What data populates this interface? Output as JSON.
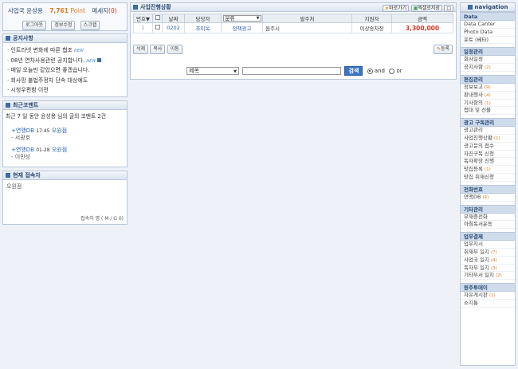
{
  "user": {
    "name": "사업국 윤성용",
    "points": "7,761",
    "points_unit": "Point",
    "messages_label": "메세지",
    "messages_count": "(0)",
    "buttons": [
      "로그아웃",
      "정보수정",
      "스크랩"
    ]
  },
  "notice": {
    "title": "공지사항",
    "items": [
      {
        "text": "인트라넷 변화에 따른 협조",
        "new": "NEW"
      },
      {
        "text": "08년 연차사용관련 공지합니다.",
        "new": "NEW"
      },
      {
        "text": "매일 오늘만 같았으면 좋겠습니다.",
        "new": ""
      },
      {
        "text": "회사망 불법주정차 단속 대상예도",
        "new": ""
      },
      {
        "text": "시청우편함 이전",
        "new": ""
      }
    ]
  },
  "comments": {
    "title": "최근코멘트",
    "summary": "최근 7 일 동안 윤성용 님의 글의 코멘트 2건",
    "items": [
      {
        "prefix": "+연맹DB",
        "time": "17:45",
        "author": "오원점",
        "text": "- 서광호"
      },
      {
        "prefix": "+연맹DB",
        "time": "01-28",
        "author": "오원점",
        "text": "- 이민성"
      }
    ]
  },
  "online": {
    "title": "현재 접속자",
    "users": [
      "오원점"
    ],
    "footer": "접속자 명 ( M / G 0)"
  },
  "main": {
    "title": "사업진행상황",
    "top_buttons": [
      "바로가기",
      "엑셀로저장"
    ],
    "columns": [
      "번호▼",
      "",
      "날짜",
      "담당자",
      "분류",
      "발주처",
      "지원자",
      "금액"
    ],
    "category_select": "분류",
    "rows": [
      {
        "no": "1",
        "date": "0202",
        "manager": "조미옥",
        "category": "정책광고",
        "client": "원주시",
        "support": "이상송차장",
        "amount": "3,300,000"
      }
    ],
    "actions": [
      "삭제",
      "복사",
      "이동"
    ],
    "register_button": "등록",
    "search": {
      "field_option": "제목",
      "value": "",
      "button": "검색",
      "radio_and": "and",
      "radio_or": "or"
    }
  },
  "nav": {
    "title": "navigation",
    "sections": [
      {
        "title": "Data",
        "items": [
          {
            "label": "Data Canter",
            "count": ""
          },
          {
            "label": "Photo Data",
            "count": ""
          },
          {
            "label": "포토 (베타)",
            "count": ""
          }
        ]
      },
      {
        "title": "일정관리",
        "items": [
          {
            "label": "회사일정",
            "count": ""
          },
          {
            "label": "공지사항",
            "count": "(2)"
          }
        ]
      },
      {
        "title": "편집관리",
        "items": [
          {
            "label": "정보보고",
            "count": "(9)"
          },
          {
            "label": "판내행사",
            "count": "(4)"
          },
          {
            "label": "기사항의",
            "count": "(1)"
          },
          {
            "label": "접대 및 선물",
            "count": ""
          }
        ]
      },
      {
        "title": "광고 구독관리",
        "items": [
          {
            "label": "광고관리",
            "count": ""
          },
          {
            "label": "사업진행상황",
            "count": "(1)"
          },
          {
            "label": "광고문의 접수",
            "count": ""
          },
          {
            "label": "자진구독 신청",
            "count": ""
          },
          {
            "label": "독자확장 진행",
            "count": ""
          },
          {
            "label": "맛집등록",
            "count": "(1)"
          },
          {
            "label": "맛집 취재신청",
            "count": ""
          }
        ]
      },
      {
        "title": "전화번호",
        "items": [
          {
            "label": "연맹DB",
            "count": "(4)"
          }
        ]
      },
      {
        "title": "기타관리",
        "items": [
          {
            "label": "부재중전화",
            "count": ""
          },
          {
            "label": "아침독서운동",
            "count": ""
          }
        ]
      },
      {
        "title": "업무결제",
        "items": [
          {
            "label": "업무지시",
            "count": ""
          },
          {
            "label": "취재부 일지",
            "count": "(7)"
          },
          {
            "label": "사업국 일지",
            "count": "(4)"
          },
          {
            "label": "독자부 일지",
            "count": "(3)"
          },
          {
            "label": "기타부서 일지",
            "count": "(2)"
          }
        ]
      },
      {
        "title": "원주투데이",
        "items": [
          {
            "label": "자유게시판",
            "count": "(1)"
          },
          {
            "label": "쇼지통",
            "count": ""
          }
        ]
      }
    ]
  },
  "colors": {
    "accent": "#3c6aa3",
    "points": "#e07a1f",
    "amount": "#d9301f",
    "link": "#2a62b5",
    "header_bg": "#dbe4ef"
  }
}
